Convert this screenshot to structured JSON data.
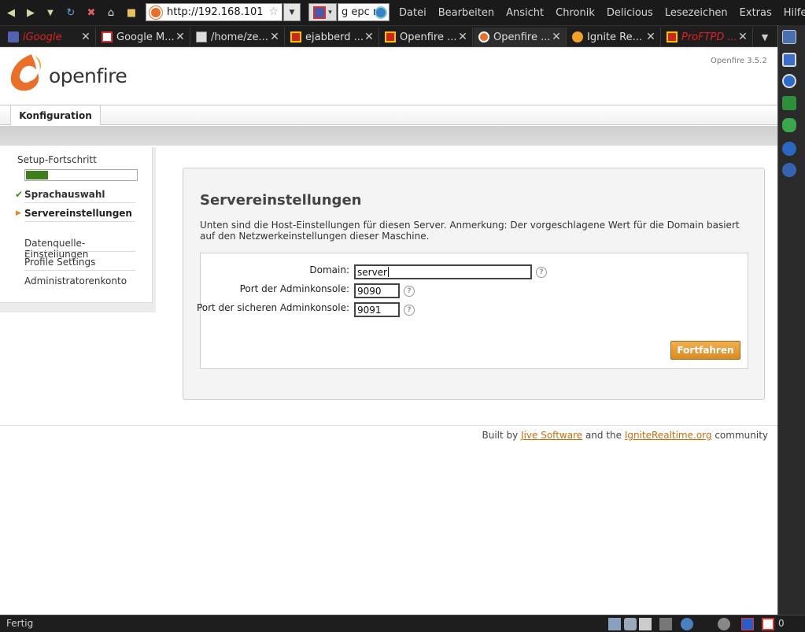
{
  "browser": {
    "url": "http://192.168.101",
    "search_value": "g epc r",
    "menus": [
      "Datei",
      "Bearbeiten",
      "Ansicht",
      "Chronik",
      "Delicious",
      "Lesezeichen",
      "Extras",
      "Hilfe"
    ],
    "tabs": [
      {
        "label": "iGoogle",
        "icon": "igoogle-icon"
      },
      {
        "label": "Google M...",
        "icon": "gmail-icon"
      },
      {
        "label": "/home/ze...",
        "icon": "folder-icon"
      },
      {
        "label": "ejabberd ...",
        "icon": "ejabberd-icon"
      },
      {
        "label": "Openfire ...",
        "icon": "openfire-icon"
      },
      {
        "label": "Openfire ...",
        "icon": "openfire-logo-icon"
      },
      {
        "label": "Ignite Re...",
        "icon": "ignite-icon"
      },
      {
        "label": "ProFTPD ...",
        "icon": "proftpd-icon"
      }
    ],
    "status": "Fertig",
    "status_count": "0"
  },
  "app": {
    "logo_text": "openfire",
    "version": "Openfire 3.5.2",
    "top_tab": "Konfiguration"
  },
  "setup": {
    "title": "Setup-Fortschritt",
    "progress_fraction": 0.2,
    "steps": [
      {
        "label": "Sprachauswahl",
        "state": "done"
      },
      {
        "label": "Servereinstellungen",
        "state": "current"
      },
      {
        "label": "Datenquelle-\nEinstellungen",
        "state": "pending"
      },
      {
        "label": "Profile Settings",
        "state": "pending"
      },
      {
        "label": "Administratorenkonto",
        "state": "pending"
      }
    ]
  },
  "panel": {
    "title": "Servereinstellungen",
    "description": "Unten sind die Host-Einstellungen für diesen Server. Anmerkung: Der vorgeschlagene Wert für die Domain basiert auf den Netzwerkeinstellungen dieser Maschine.",
    "fields": [
      {
        "label": "Domain:",
        "value": "server"
      },
      {
        "label": "Port der Adminkonsole:",
        "value": "9090"
      },
      {
        "label": "Port der sicheren Adminkonsole:",
        "value": "9091"
      }
    ],
    "button": "Fortfahren"
  },
  "footer": {
    "prefix": "Built by ",
    "link1": "Jive Software",
    "middle": " and the ",
    "link2": "IgniteRealtime.org",
    "suffix": " community"
  },
  "colors": {
    "accent": "#d98a22",
    "progress": "#3f7d1e",
    "link": "#c86d0a"
  }
}
